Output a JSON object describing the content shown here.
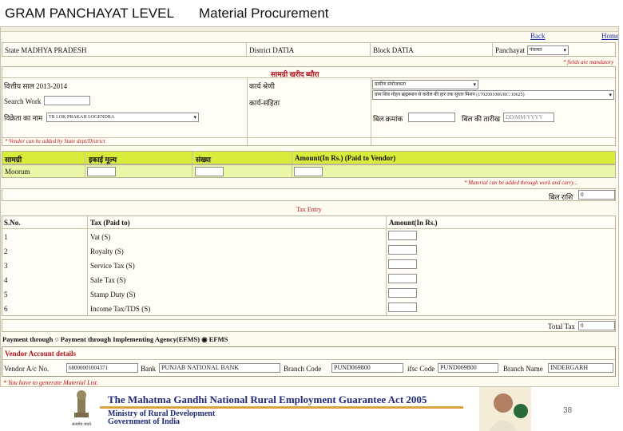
{
  "slide": {
    "title_left": "GRAM PANCHAYAT LEVEL",
    "title_right": "Material Procurement",
    "page_number": "38"
  },
  "nav": {
    "back": "Back",
    "home": "Home"
  },
  "location": {
    "state": "State MADHYA PRADESH",
    "district": "District DATIA",
    "block": "Block DATIA",
    "panchayat_label": "Panchayat",
    "panchayat_value": "पंचायत"
  },
  "notes": {
    "mandatory": "* fields are mandatory",
    "vendor_note": "* Vendor can be added by State dept/District",
    "measure_note": "* Material can be added through work and carry...",
    "material_list": "* You have to generate Material List."
  },
  "form": {
    "section_title": "सामग्री खरीद ब्यौरा",
    "fin_year": "वित्तीय साल  2013-2014",
    "work_category_label": "कार्य श्रेणी",
    "work_category_value": "ग्रामीण संयोजकता",
    "search_work_label": "Search Work",
    "work_code_label": "कार्य-संहिता",
    "work_code_value": "ग्राम शिव मोहन ब्रह्मस्थान से करोल की हार तक सुधार मिशन (1702001006/RC/10625)",
    "vendor_label": "विक्रेता का नाम",
    "vendor_value": "TR LOK PRAKAH LOGENDRA",
    "bill_no_label": "बिल क्रमांक",
    "bill_date_label": "बिल की तारीख",
    "bill_date_placeholder": "DD/MM/YYYY"
  },
  "material_table": {
    "headers": [
      "सामग्री",
      "इकाई मूल्य",
      "संख्या",
      "Amount(In Rs.) (Paid to Vendor)"
    ],
    "row_label": "Moorum",
    "bill_total_label": "बिल राशि",
    "bill_total_value": "0"
  },
  "tax": {
    "title": "Tax Entry",
    "col_sno": "S.No.",
    "col_tax": "Tax (Paid to)",
    "col_amount": "Amount(In Rs.)",
    "rows": [
      {
        "sno": "1",
        "name": "Vat    (S)"
      },
      {
        "sno": "2",
        "name": "Royalty    (S)"
      },
      {
        "sno": "3",
        "name": "Service Tax    (S)"
      },
      {
        "sno": "4",
        "name": "Sale Tax    (S)"
      },
      {
        "sno": "5",
        "name": "Stamp Duty    (S)"
      },
      {
        "sno": "6",
        "name": "Income Tax/TDS    (S)"
      }
    ],
    "total_label": "Total Tax",
    "total_value": "0"
  },
  "payment": {
    "label": "Payment through",
    "option_1": "Payment through Implementing Agency(EFMS)",
    "option_2": "EFMS",
    "selected": "EFMS"
  },
  "vendor_account": {
    "title": "Vendor Account details",
    "ac_no_label": "Vendor A/c No.",
    "ac_no_value": "68000001004371",
    "bank_label": "Bank",
    "bank_value": "PUNJAB NATIONAL BANK",
    "branch_code_label": "Branch Code",
    "branch_code_value": "PUND069800",
    "ifsc_label": "ifsc Code",
    "ifsc_value": "PUND069800",
    "branch_name_label": "Branch Name",
    "branch_name_value": "INDERGARH"
  },
  "banner": {
    "title": "The Mahatma Gandhi National Rural Employment Guarantee Act 2005",
    "line1": "Ministry of Rural Development",
    "line2": "Government of India",
    "emblem_caption": "सत्यमेव जयते"
  },
  "colors": {
    "header_yellow": "#d9ec3b",
    "row_green": "#ebf7a8",
    "link_blue": "#1a2fa8",
    "note_red": "#c0131f"
  }
}
